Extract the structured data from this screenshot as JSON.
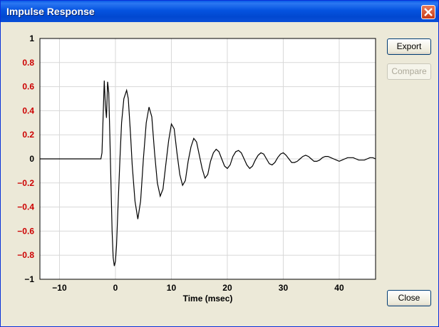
{
  "window": {
    "title": "Impulse Response"
  },
  "buttons": {
    "export": "Export",
    "compare": "Compare",
    "close": "Close"
  },
  "colors": {
    "ytick_text": "#cc0000",
    "trace": "#000000",
    "grid": "#d8d8d8"
  },
  "chart_data": {
    "type": "line",
    "xlabel": "Time (msec)",
    "ylabel": "",
    "xlim": [
      -13.5,
      46.5
    ],
    "ylim": [
      -1,
      1
    ],
    "xticks": [
      -10,
      0,
      10,
      20,
      30,
      40
    ],
    "yticks": [
      1,
      0.8,
      0.6,
      0.4,
      0.2,
      0,
      -0.2,
      -0.4,
      -0.6,
      -0.8,
      -1
    ],
    "ytick_labels": [
      "1",
      "0.8",
      "0.6",
      "0.4",
      "0.2",
      "0",
      "−0.2",
      "−0.4",
      "−0.6",
      "−0.8",
      "−1"
    ],
    "grid": true,
    "series": [
      {
        "x": [
          -13.5,
          -2.6,
          -2.4,
          -2.2,
          -2.0,
          -1.8,
          -1.6,
          -1.4,
          -1.2,
          -1.0,
          -0.8,
          -0.6,
          -0.4,
          -0.2,
          0.0,
          0.2,
          0.5,
          0.8,
          1.1,
          1.5,
          2.0,
          2.3,
          2.7,
          3.0,
          3.5,
          4.0,
          4.5,
          5.0,
          5.5,
          6.0,
          6.5,
          7.0,
          7.5,
          8.0,
          8.5,
          9.0,
          9.5,
          10.0,
          10.5,
          11.0,
          11.5,
          12.0,
          12.5,
          13.0,
          13.5,
          14.0,
          14.5,
          15.0,
          15.5,
          16.0,
          16.5,
          17.0,
          17.5,
          18.0,
          18.5,
          19.0,
          19.5,
          20.0,
          20.5,
          21.0,
          21.5,
          22.0,
          22.5,
          23.0,
          23.5,
          24.0,
          24.5,
          25.0,
          25.5,
          26.0,
          26.5,
          27.0,
          27.5,
          28.0,
          28.5,
          29.0,
          29.5,
          30.0,
          30.5,
          31.0,
          31.5,
          32.0,
          32.5,
          33.0,
          33.5,
          34.0,
          34.5,
          35.0,
          35.5,
          36.0,
          36.5,
          37.0,
          37.5,
          38.0,
          38.5,
          39.0,
          39.5,
          40.0,
          40.5,
          41.0,
          41.5,
          42.0,
          42.5,
          43.0,
          43.5,
          44.0,
          44.5,
          45.0,
          45.5,
          46.0,
          46.5
        ],
        "y": [
          0,
          0,
          0.05,
          0.35,
          0.65,
          0.45,
          0.34,
          0.64,
          0.55,
          0.2,
          -0.2,
          -0.6,
          -0.82,
          -0.89,
          -0.85,
          -0.72,
          -0.35,
          0.0,
          0.3,
          0.5,
          0.57,
          0.5,
          0.2,
          -0.05,
          -0.35,
          -0.5,
          -0.35,
          0.0,
          0.3,
          0.43,
          0.35,
          0.05,
          -0.2,
          -0.31,
          -0.25,
          -0.05,
          0.15,
          0.29,
          0.25,
          0.05,
          -0.13,
          -0.22,
          -0.18,
          -0.02,
          0.1,
          0.17,
          0.14,
          0.03,
          -0.08,
          -0.16,
          -0.13,
          -0.02,
          0.05,
          0.08,
          0.06,
          0.0,
          -0.06,
          -0.08,
          -0.05,
          0.02,
          0.06,
          0.07,
          0.05,
          0.0,
          -0.05,
          -0.08,
          -0.06,
          -0.01,
          0.03,
          0.05,
          0.04,
          0.0,
          -0.04,
          -0.05,
          -0.03,
          0.01,
          0.04,
          0.05,
          0.03,
          0.0,
          -0.03,
          -0.03,
          -0.02,
          0.0,
          0.02,
          0.03,
          0.02,
          0.0,
          -0.02,
          -0.02,
          -0.01,
          0.01,
          0.02,
          0.02,
          0.01,
          0.0,
          -0.01,
          -0.02,
          -0.01,
          0.0,
          0.01,
          0.01,
          0.01,
          0.0,
          -0.01,
          -0.01,
          -0.01,
          0.0,
          0.01,
          0.01,
          0.0
        ]
      }
    ]
  }
}
